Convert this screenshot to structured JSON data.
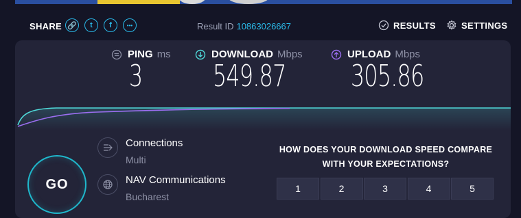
{
  "share": {
    "label": "SHARE",
    "icons": [
      "link-icon",
      "twitter-icon",
      "facebook-icon",
      "more-icon"
    ],
    "icon_glyphs": [
      "🔗",
      "t",
      "f",
      "•••"
    ]
  },
  "result": {
    "label": "Result ID",
    "id": "10863026667"
  },
  "nav": {
    "results": "RESULTS",
    "settings": "SETTINGS"
  },
  "metrics": {
    "ping": {
      "label": "PING",
      "unit": "ms",
      "value": "3"
    },
    "download": {
      "label": "DOWNLOAD",
      "unit": "Mbps",
      "value": "549.87"
    },
    "upload": {
      "label": "UPLOAD",
      "unit": "Mbps",
      "value": "305.86"
    }
  },
  "go": {
    "label": "GO"
  },
  "connections": {
    "title": "Connections",
    "value": "Multi"
  },
  "server": {
    "title": "NAV Communications",
    "location": "Bucharest"
  },
  "survey": {
    "question_line1": "HOW DOES YOUR DOWNLOAD SPEED COMPARE",
    "question_line2": "WITH YOUR EXPECTATIONS?",
    "options": [
      "1",
      "2",
      "3",
      "4",
      "5"
    ]
  },
  "colors": {
    "accent": "#2ab9e8",
    "download_line": "#4fd9d9",
    "upload_line": "#9b6ef0",
    "background": "#141526",
    "panel": "#232438"
  }
}
